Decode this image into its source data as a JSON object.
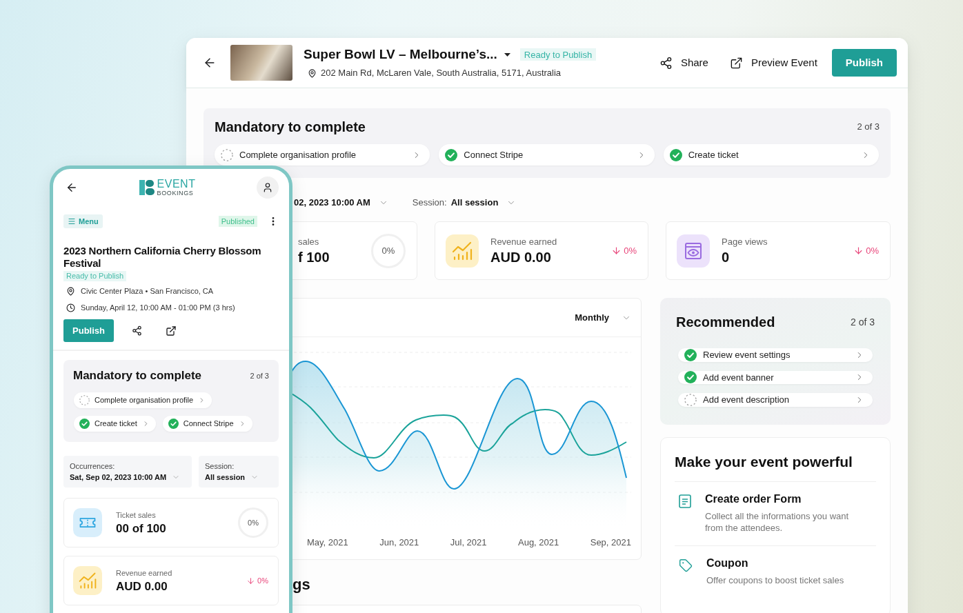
{
  "desktop": {
    "header": {
      "title": "Super Bowl LV – Melbourne’s...",
      "status": "Ready to Publish",
      "address": "202 Main Rd, McLaren Vale, South Australia, 5171, Australia",
      "actions": [
        {
          "kind": "share",
          "label": "Share"
        },
        {
          "kind": "preview",
          "label": "Preview Event"
        }
      ],
      "publish": "Publish"
    },
    "mandatory": {
      "title": "Mandatory to complete",
      "progress": "2 of 3",
      "tasks": [
        {
          "label": "Complete organisation profile",
          "done": false
        },
        {
          "label": "Connect Stripe",
          "done": true
        },
        {
          "label": "Create ticket",
          "done": true
        }
      ]
    },
    "filters": [
      {
        "value": "02, 2023 10:00 AM"
      },
      {
        "label": "Session:",
        "value": "All session"
      }
    ],
    "stats": [
      {
        "kind": "sales",
        "label": "sales",
        "value": "f 100",
        "percent": "0%"
      },
      {
        "kind": "revenue",
        "label": "Revenue earned",
        "value": "AUD 0.00",
        "change": "0%"
      },
      {
        "kind": "views",
        "label": "Page views",
        "value": "0",
        "change": "0%"
      }
    ],
    "chart": {
      "period": "Monthly",
      "x_labels": [
        "May, 2021",
        "Jun, 2021",
        "Jul, 2021",
        "Aug, 2021",
        "Sep, 2021"
      ]
    },
    "next_section_title": "gs",
    "recommended": {
      "title": "Recommended",
      "progress": "2 of 3",
      "tasks": [
        {
          "label": "Review event settings",
          "done": true
        },
        {
          "label": "Add event banner",
          "done": true
        },
        {
          "label": "Add event description",
          "done": false
        }
      ]
    },
    "powerful": {
      "title": "Make your event powerful",
      "features": [
        {
          "kind": "form",
          "title": "Create order Form",
          "description": "Collect all the informations you want from the attendees."
        },
        {
          "kind": "coupon",
          "title": "Coupon",
          "description": "Offer coupons to boost ticket sales"
        }
      ]
    }
  },
  "mobile": {
    "brand": {
      "name": "EVENT",
      "subtitle": "BOOKINGS"
    },
    "menu": "Menu",
    "status": "Published",
    "event": {
      "title": "2023 Northern California Cherry Blossom Festival",
      "status": "Ready to Publish",
      "location": "Civic Center Plaza • San Francisco, CA",
      "time": "Sunday, April 12, 10:00 AM - 01:00 PM (3 hrs)"
    },
    "publish": "Publish",
    "mandatory": {
      "title": "Mandatory to complete",
      "progress": "2 of 3",
      "tasks": [
        {
          "label": "Complete organisation profile",
          "done": false
        },
        {
          "label": "Create ticket",
          "done": true
        },
        {
          "label": "Connect Stripe",
          "done": true
        }
      ]
    },
    "filters": [
      {
        "label": "Occurrences:",
        "value": "Sat, Sep 02, 2023 10:00 AM"
      },
      {
        "label": "Session:",
        "value": "All session"
      }
    ],
    "stats": [
      {
        "kind": "ticket",
        "label": "Ticket sales",
        "value": "00 of 100",
        "percent": "0%"
      },
      {
        "kind": "revenue",
        "label": "Revenue earned",
        "value": "AUD 0.00",
        "change": "0%"
      }
    ]
  }
}
